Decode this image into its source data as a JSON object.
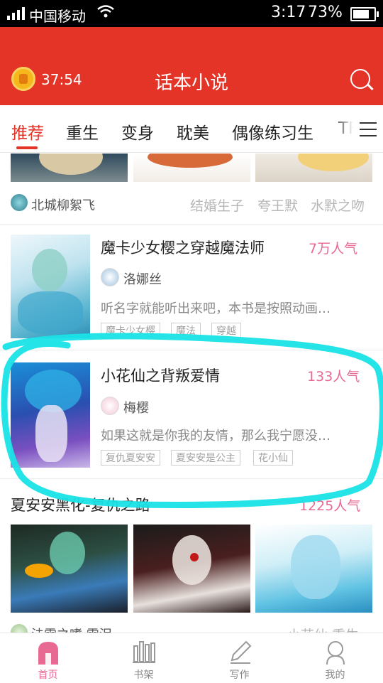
{
  "status_bar": {
    "carrier": "中国移动",
    "time": "3:17",
    "battery": "73%"
  },
  "header": {
    "timer": "37:54",
    "title": "话本小说"
  },
  "tabs": [
    {
      "label": "推荐",
      "active": true
    },
    {
      "label": "重生"
    },
    {
      "label": "变身"
    },
    {
      "label": "耽美"
    },
    {
      "label": "偶像练习生"
    },
    {
      "label": "TF"
    }
  ],
  "top_row": {
    "author": "北城柳絮飞",
    "tags": [
      "结婚生子",
      "夸王默",
      "水默之吻"
    ]
  },
  "books": [
    {
      "title": "魔卡少女樱之穿越魔法师",
      "popularity": "7万人气",
      "author": "洛娜丝",
      "description": "听名字就能听出来吧，本书是按照动画…",
      "tags": [
        "魔卡少女樱",
        "魔法",
        "穿越"
      ]
    },
    {
      "title": "小花仙之背叛爱情",
      "popularity": "133人气",
      "author": "梅樱",
      "description": "如果这就是你我的友情，那么我宁愿没…",
      "tags": [
        "复仇夏安安",
        "夏安安是公主",
        "花小仙"
      ]
    }
  ],
  "collection": {
    "title": "夏安安黑化-复仇之路",
    "popularity": "1225人气"
  },
  "partial_row": {
    "author": "法雷之嗜 雷泪",
    "tags": "小花仙 重生"
  },
  "bottom_nav": [
    {
      "label": "首页",
      "icon": "home-icon",
      "active": true
    },
    {
      "label": "书架",
      "icon": "bookshelf-icon"
    },
    {
      "label": "写作",
      "icon": "pen-icon"
    },
    {
      "label": "我的",
      "icon": "profile-icon"
    }
  ],
  "colors": {
    "brand_red": "#e43428",
    "popularity_pink": "#e86a93",
    "annotation_cyan": "#19e3e6"
  }
}
